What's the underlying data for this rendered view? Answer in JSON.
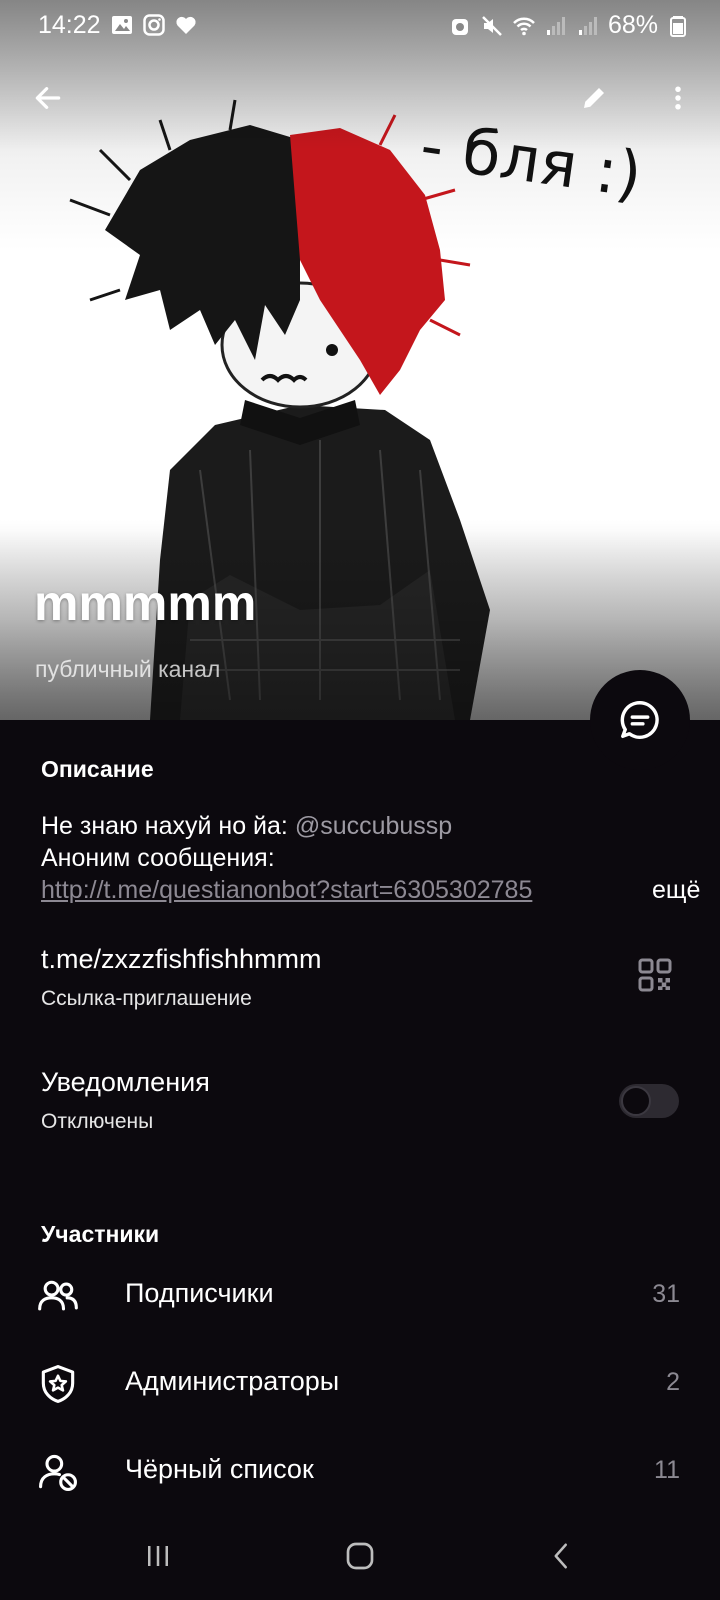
{
  "status": {
    "time": "14:22",
    "battery": "68%",
    "left_icons": [
      "gallery-icon",
      "instagram-icon",
      "heart-icon"
    ],
    "right_icons": [
      "alarm-icon",
      "mute-icon",
      "wifi-icon",
      "signal-icon",
      "signal-icon",
      "battery-icon"
    ]
  },
  "appbar": {
    "back_icon": "arrow-left-icon",
    "edit_icon": "pencil-icon",
    "more_icon": "more-vertical-icon"
  },
  "header": {
    "photo_caption": "- бля :)",
    "title": "mmmmm",
    "subtitle": "публичный канал",
    "fab_icon": "chat-bubble-icon"
  },
  "description": {
    "header": "Описание",
    "line1_text": "Не знаю нахуй но йа: ",
    "line1_mention": "@succubussp",
    "line2_text": "Аноним сообщения:",
    "link": "http://t.me/questianonbot?start=6305302785",
    "more_label": "ещё"
  },
  "invite": {
    "link": "t.me/zxzzfishfishhmmm",
    "label": "Ссылка-приглашение",
    "qr_icon": "qr-code-icon"
  },
  "notifications": {
    "title": "Уведомления",
    "status": "Отключены",
    "enabled": false
  },
  "members": {
    "header": "Участники",
    "items": [
      {
        "label": "Подписчики",
        "count": "31",
        "icon": "users-icon"
      },
      {
        "label": "Администраторы",
        "count": "2",
        "icon": "shield-star-icon"
      },
      {
        "label": "Чёрный список",
        "count": "11",
        "icon": "user-blocked-icon"
      }
    ]
  },
  "colors": {
    "background": "#0c090e",
    "secondary_text": "#8c8992",
    "hair_red": "#c4161c"
  },
  "navbar": {
    "icons": [
      "recent-apps-icon",
      "home-icon",
      "back-icon"
    ]
  }
}
